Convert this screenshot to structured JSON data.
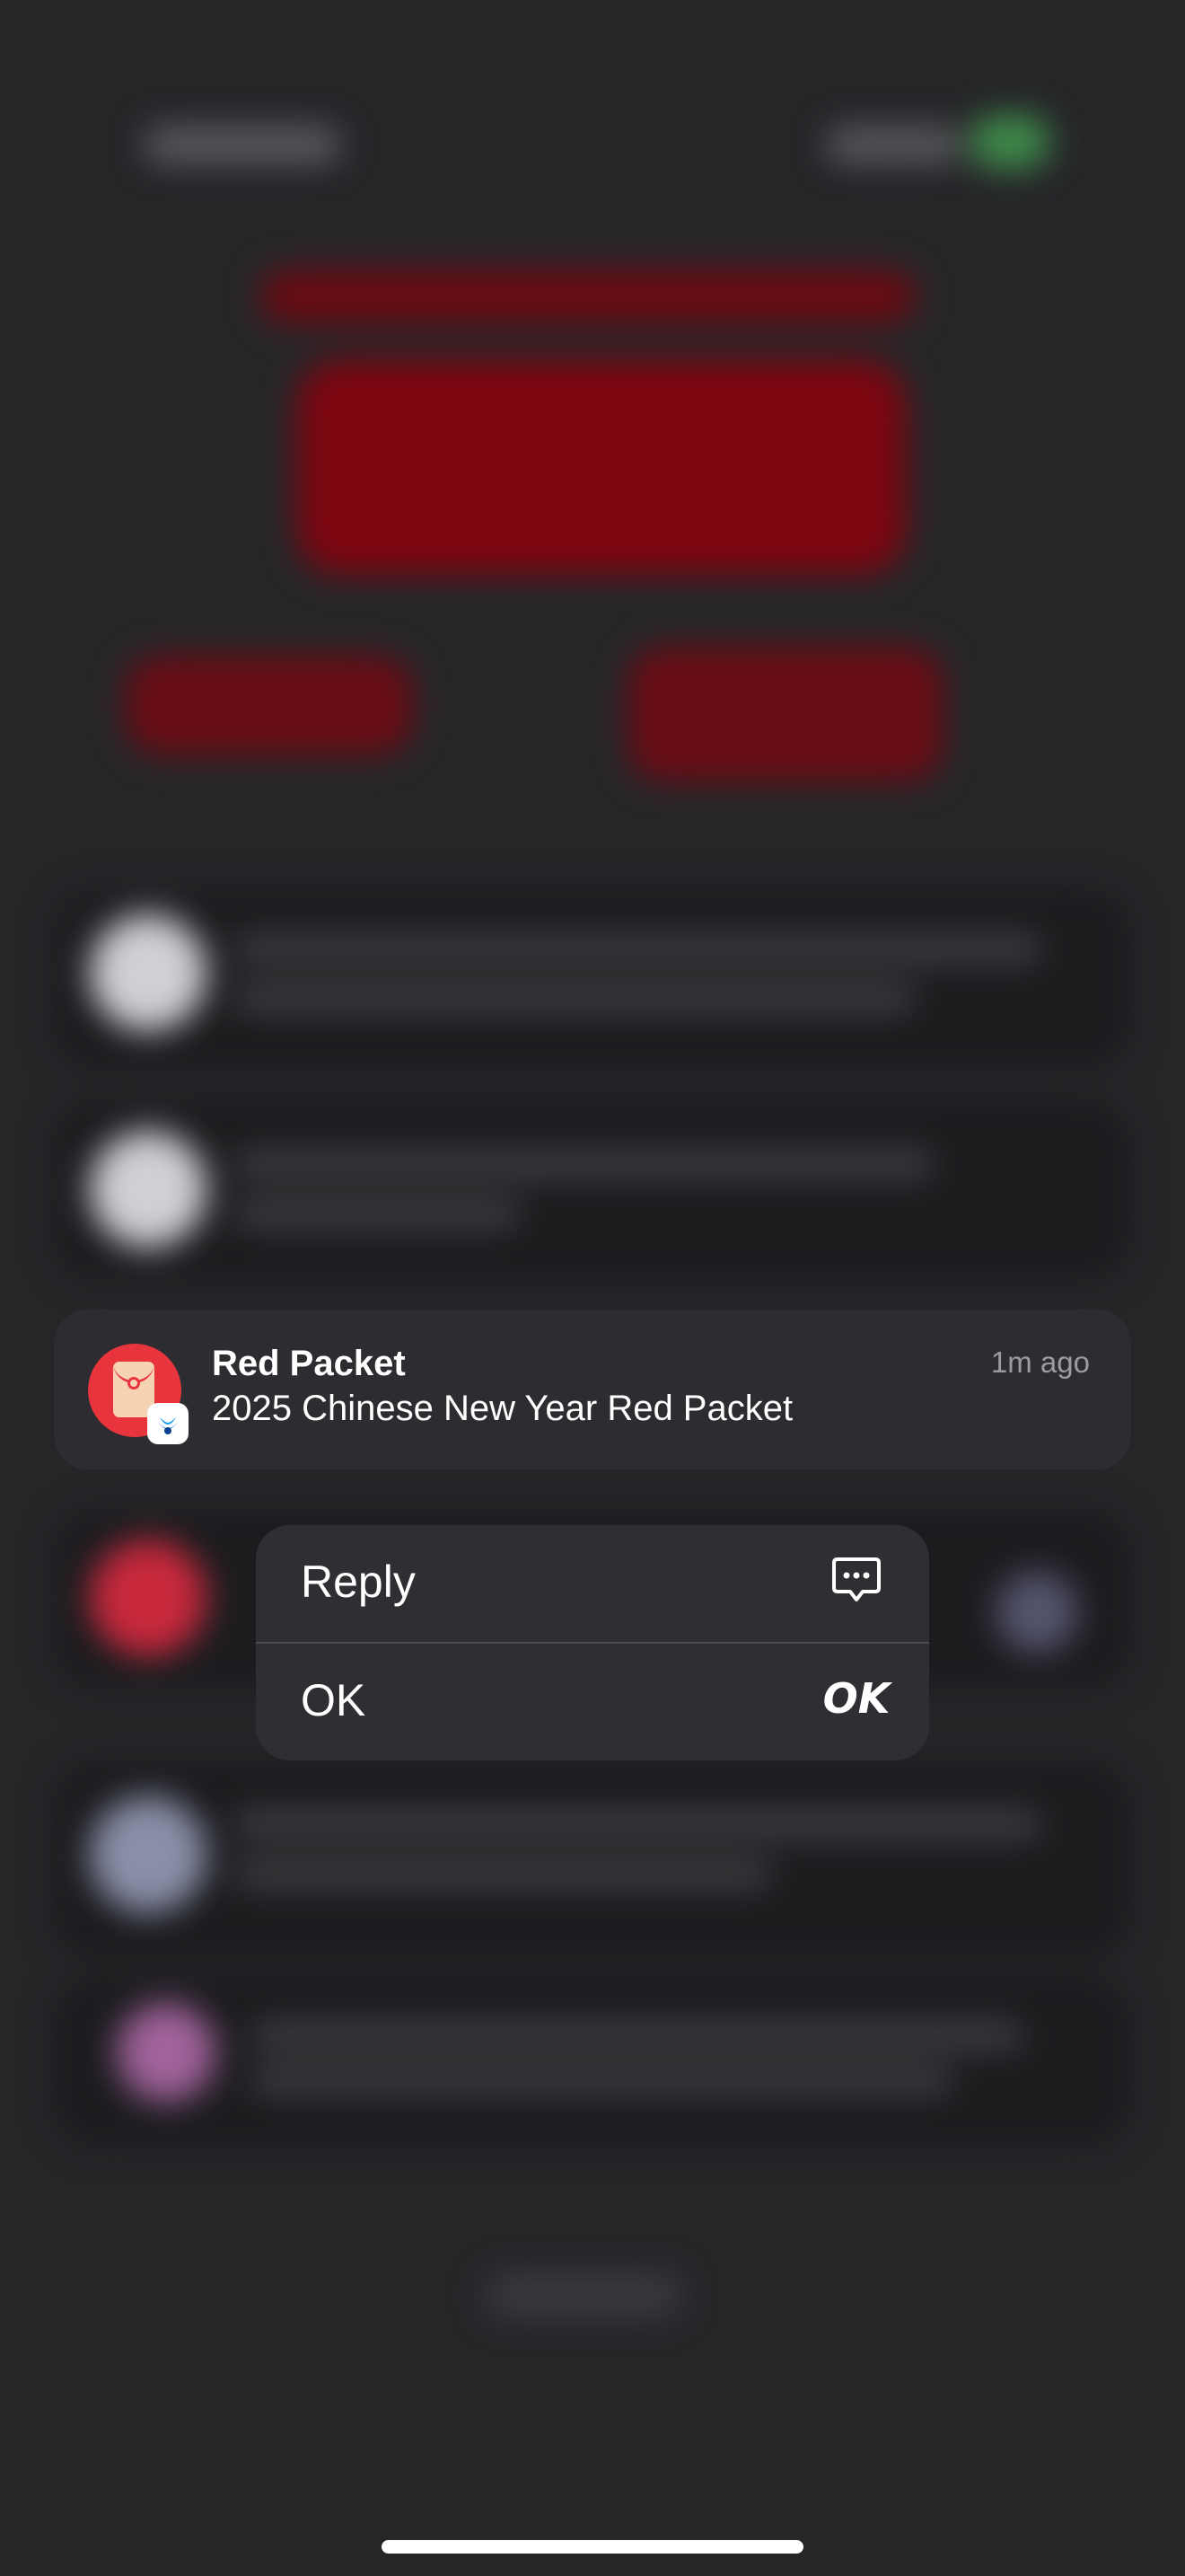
{
  "notification": {
    "title": "Red Packet",
    "body": "2025 Chinese New Year Red Packet",
    "time": "1m ago",
    "app_icon": "red-packet-icon",
    "badge_icon": "source-app-badge-icon"
  },
  "context_menu": {
    "items": [
      {
        "label": "Reply",
        "icon": "message-reply-icon"
      },
      {
        "label": "OK",
        "icon": "ok-icon",
        "icon_glyph": "OK"
      }
    ]
  },
  "colors": {
    "background": "#262629",
    "notification_bg": "#2d2d31",
    "menu_bg": "#2f2f33",
    "app_icon_red": "#e8343d",
    "badge_blue": "#1f7ae0"
  }
}
